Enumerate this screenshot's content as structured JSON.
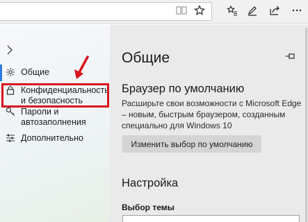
{
  "toolbar": {
    "icons": [
      "reading-view-icon",
      "favorite-star-icon",
      "favorites-hub-icon",
      "notes-pen-icon",
      "share-icon",
      "more-icon"
    ]
  },
  "sidebar": {
    "items": [
      {
        "label": "Общие",
        "icon": "gear-icon"
      },
      {
        "label": "Конфиденциальность и безопасность",
        "icon": "lock-icon"
      },
      {
        "label": "Пароли и автозаполнения",
        "icon": "key-icon"
      },
      {
        "label": "Дополнительно",
        "icon": "sliders-icon"
      }
    ],
    "active_index": 0,
    "highlight_color": "#d9121c",
    "accent_color": "#2d7de0"
  },
  "panel": {
    "title": "Общие",
    "default_browser": {
      "heading": "Браузер по умолчанию",
      "description": "Расширьте свои возможности с Microsoft Edge – новым, быстрым браузером, созданным специально для Windows 10",
      "button_label": "Изменить выбор по умолчанию"
    },
    "customize": {
      "heading": "Настройка",
      "theme_label": "Выбор темы"
    }
  }
}
